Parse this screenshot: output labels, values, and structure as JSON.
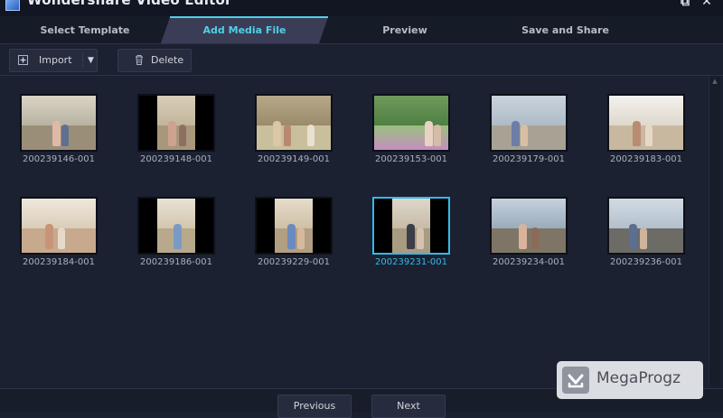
{
  "window": {
    "title": "Wondershare Video Editor",
    "restore_icon": "⧉",
    "close_icon": "✕"
  },
  "tabs": [
    {
      "label": "Select Template",
      "active": false
    },
    {
      "label": "Add Media File",
      "active": true
    },
    {
      "label": "Preview",
      "active": false
    },
    {
      "label": "Save and Share",
      "active": false
    }
  ],
  "toolbar": {
    "import_label": "Import",
    "import_icon": "import-icon",
    "dropdown_caret": "▼",
    "delete_label": "Delete",
    "delete_icon": "trash-icon"
  },
  "media": [
    {
      "name": "200239146-001",
      "selected": false
    },
    {
      "name": "200239148-001",
      "selected": false
    },
    {
      "name": "200239149-001",
      "selected": false
    },
    {
      "name": "200239153-001",
      "selected": false
    },
    {
      "name": "200239179-001",
      "selected": false
    },
    {
      "name": "200239183-001",
      "selected": false
    },
    {
      "name": "200239184-001",
      "selected": false
    },
    {
      "name": "200239186-001",
      "selected": false
    },
    {
      "name": "200239229-001",
      "selected": false
    },
    {
      "name": "200239231-001",
      "selected": true
    },
    {
      "name": "200239234-001",
      "selected": false
    },
    {
      "name": "200239236-001",
      "selected": false
    }
  ],
  "footer": {
    "previous_label": "Previous",
    "next_label": "Next"
  },
  "watermark": {
    "text": "MegaProgz"
  },
  "colors": {
    "accent": "#4fd0e9",
    "selected": "#35b9ea",
    "background": "#1b2131"
  }
}
